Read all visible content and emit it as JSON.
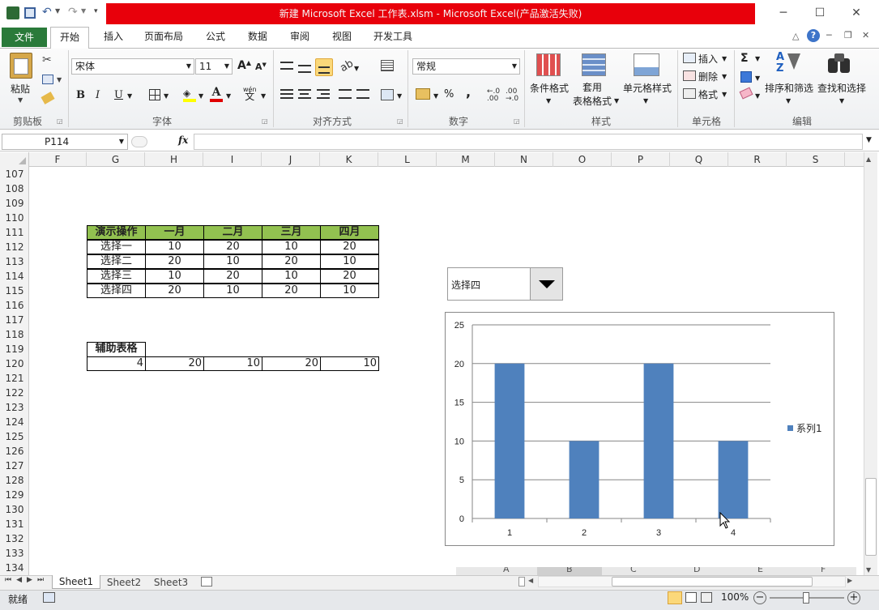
{
  "window": {
    "title": "新建 Microsoft Excel 工作表.xlsm  -  Microsoft Excel(产品激活失败)",
    "controls": [
      "─",
      "☐",
      "✕"
    ]
  },
  "ribbon_tabs": [
    "文件",
    "开始",
    "插入",
    "页面布局",
    "公式",
    "数据",
    "审阅",
    "视图",
    "开发工具"
  ],
  "clipboard": {
    "paste": "粘贴",
    "group": "剪贴板"
  },
  "font": {
    "name": "宋体",
    "size": "11",
    "group": "字体",
    "bold": "B",
    "italic": "I",
    "underline": "U",
    "grow": "A",
    "shrink": "A",
    "color_letter": "A",
    "phonetic": "wén",
    "phonetic_char": "文"
  },
  "alignment": {
    "group": "对齐方式"
  },
  "number": {
    "format": "常规",
    "group": "数字",
    "percent": "%",
    "comma": ",",
    "inc_dec": "←.0\n.00",
    "dec_dec": ".00\n→.0"
  },
  "styles": {
    "conditional": "条件格式",
    "table": "套用\n表格格式",
    "cell": "单元格样式",
    "group": "样式"
  },
  "cells": {
    "insert": "插入",
    "delete": "删除",
    "format": "格式",
    "group": "单元格"
  },
  "editing": {
    "sum": "Σ",
    "sort": "排序和筛选",
    "find": "查找和选择",
    "group": "编辑"
  },
  "formula_bar": {
    "name_box": "P114",
    "fx": "fx",
    "value": ""
  },
  "columns": [
    "F",
    "G",
    "H",
    "I",
    "J",
    "K",
    "L",
    "M",
    "N",
    "O",
    "P",
    "Q",
    "R",
    "S"
  ],
  "rows": [
    "107",
    "108",
    "109",
    "110",
    "111",
    "112",
    "113",
    "114",
    "115",
    "116",
    "117",
    "118",
    "119",
    "120",
    "121",
    "122",
    "123",
    "124",
    "125",
    "126",
    "127",
    "128",
    "129",
    "130",
    "131",
    "132",
    "133",
    "134"
  ],
  "table1": {
    "headers": [
      "演示操作",
      "一月",
      "二月",
      "三月",
      "四月"
    ],
    "rows": [
      [
        "选择一",
        "10",
        "20",
        "10",
        "20"
      ],
      [
        "选择二",
        "20",
        "10",
        "20",
        "10"
      ],
      [
        "选择三",
        "10",
        "20",
        "10",
        "20"
      ],
      [
        "选择四",
        "20",
        "10",
        "20",
        "10"
      ]
    ]
  },
  "table2": {
    "header": "辅助表格",
    "values": [
      "4",
      "20",
      "10",
      "20",
      "10"
    ]
  },
  "dropdown": {
    "value": "选择四"
  },
  "chart_data": {
    "type": "bar",
    "categories": [
      "1",
      "2",
      "3",
      "4"
    ],
    "series": [
      {
        "name": "系列1",
        "values": [
          20,
          10,
          20,
          10
        ],
        "color": "#4f81bd"
      }
    ],
    "ylim": [
      0,
      25
    ],
    "yticks": [
      "0",
      "5",
      "10",
      "15",
      "20",
      "25"
    ],
    "grid": true,
    "legend": "right"
  },
  "chart_data_table_overlay": [
    "A",
    "B",
    "C",
    "D",
    "E",
    "F"
  ],
  "sheets": [
    "Sheet1",
    "Sheet2",
    "Sheet3"
  ],
  "status": {
    "mode": "就绪",
    "zoom": "100%"
  }
}
